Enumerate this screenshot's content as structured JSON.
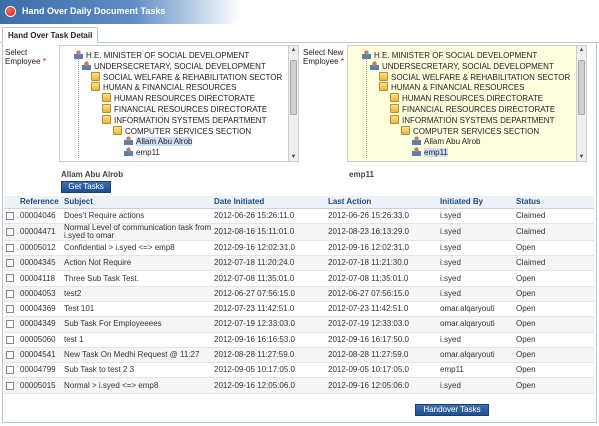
{
  "window": {
    "title": "Hand Over Daily Document Tasks"
  },
  "tabs": [
    {
      "label": "Hand Over Task Detail"
    }
  ],
  "select_employee": {
    "label": "Select Employee",
    "required_mark": "*",
    "tree": [
      {
        "label": "H.E. MINISTER OF SOCIAL DEVELOPMENT",
        "icon": "person-icon"
      },
      {
        "label": "UNDERSECRETARY, SOCIAL DEVELOPMENT",
        "icon": "person-icon"
      },
      {
        "label": "SOCIAL WELFARE & REHABILITATION SECTOR",
        "icon": "folder-icon"
      },
      {
        "label": "HUMAN & FINANCIAL RESOURCES",
        "icon": "folder-icon"
      },
      {
        "label": "HUMAN RESOURCES DIRECTORATE",
        "icon": "folder-icon"
      },
      {
        "label": "FINANCIAL RESOURCES DIRECTORATE",
        "icon": "folder-icon"
      },
      {
        "label": "INFORMATION SYSTEMS DEPARTMENT",
        "icon": "folder-icon"
      },
      {
        "label": "COMPUTER SERVICES SECTION",
        "icon": "folder-icon"
      },
      {
        "label": "Allam Abu Alrob",
        "icon": "person-icon",
        "selected": true
      },
      {
        "label": "emp11",
        "icon": "person-icon"
      }
    ],
    "selected_name": "Allam Abu Alrob",
    "button": "Get Tasks"
  },
  "select_new_employee": {
    "label": "Select New Employee",
    "required_mark": "*",
    "tree": [
      {
        "label": "H.E. MINISTER OF SOCIAL DEVELOPMENT",
        "icon": "person-icon"
      },
      {
        "label": "UNDERSECRETARY, SOCIAL DEVELOPMENT",
        "icon": "person-icon"
      },
      {
        "label": "SOCIAL WELFARE & REHABILITATION SECTOR",
        "icon": "folder-icon"
      },
      {
        "label": "HUMAN & FINANCIAL RESOURCES",
        "icon": "folder-icon"
      },
      {
        "label": "HUMAN RESOURCES DIRECTORATE",
        "icon": "folder-icon"
      },
      {
        "label": "FINANCIAL RESOURCES DIRECTORATE",
        "icon": "folder-icon"
      },
      {
        "label": "INFORMATION SYSTEMS DEPARTMENT",
        "icon": "folder-icon"
      },
      {
        "label": "COMPUTER SERVICES SECTION",
        "icon": "folder-icon"
      },
      {
        "label": "Allam Abu Alrob",
        "icon": "person-icon"
      },
      {
        "label": "emp11",
        "icon": "person-icon",
        "selected": true
      }
    ],
    "selected_name": "emp11"
  },
  "grid": {
    "columns": [
      "",
      "Reference",
      "Subject",
      "Date Initiated",
      "Last Action",
      "Initiated By",
      "Status"
    ],
    "rows": [
      [
        "00004046",
        "Does't Require actions",
        "2012-06-26 15:26:11.0",
        "2012-06-26 15:26:33.0",
        "i.syed",
        "Claimed"
      ],
      [
        "00004471",
        "Normal Level of communication task from i.syed to omar",
        "2012-08-16 15:11:01.0",
        "2012-08-23 16:13:29.0",
        "i.syed",
        "Claimed"
      ],
      [
        "00005012",
        "Confidential > i.syed <=> emp8",
        "2012-09-16 12:02:31.0",
        "2012-09-16 12:02:31.0",
        "i.syed",
        "Open"
      ],
      [
        "00004345",
        "Action Not Require",
        "2012-07-18 11:20:24.0",
        "2012-07-18 11:21:30.0",
        "i.syed",
        "Claimed"
      ],
      [
        "00004118",
        "Three Sub Task Test.",
        "2012-07-08 11:35:01.0",
        "2012-07-08 11:35:01.0",
        "i.syed",
        "Open"
      ],
      [
        "00004053",
        "test2",
        "2012-06-27 07:56:15.0",
        "2012-06-27 07:56:15.0",
        "i.syed",
        "Open"
      ],
      [
        "00004369",
        "Test 101",
        "2012-07-23 11:42:51.0",
        "2012-07-23 11:42:51.0",
        "omar.alqaryouti",
        "Open"
      ],
      [
        "00004349",
        "Sub Task For Employeeees",
        "2012-07-19 12:33:03.0",
        "2012-07-19 12:33:03.0",
        "omar.alqaryouti",
        "Open"
      ],
      [
        "00005060",
        "test 1",
        "2012-09-16 16:16:53.0",
        "2012-09-16 16:17:50.0",
        "i.syed",
        "Open"
      ],
      [
        "00004541",
        "New Task On Medhi Request @ 11:27",
        "2012-08-28 11:27:59.0",
        "2012-08-28 11:27:59.0",
        "omar.alqaryouti",
        "Open"
      ],
      [
        "00004799",
        "Sub Task to test 2 3",
        "2012-09-05 10:17:05.0",
        "2012-09-05 10:17:05.0",
        "emp11",
        "Open"
      ],
      [
        "00005015",
        "Normal > i.syed <=> emp8",
        "2012-09-16 12:05:06.0",
        "2012-09-16 12:05:06.0",
        "i.syed",
        "Open"
      ]
    ]
  },
  "handover_button": "Handover Tasks",
  "colors": {
    "title_band": "#3d6ea8",
    "header_text": "#1c4a8a",
    "button": "#2b5c9e",
    "new_employee_bg": "#ffffe0"
  }
}
